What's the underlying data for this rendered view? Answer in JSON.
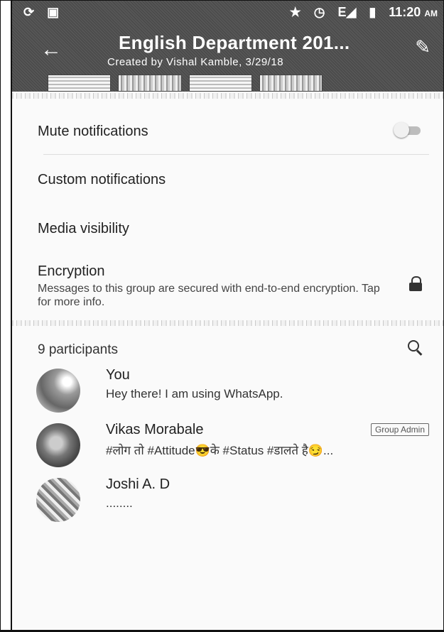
{
  "status_bar": {
    "left_icons": [
      "sync-icon",
      "gallery-icon"
    ],
    "right_icons": [
      "star-icon",
      "alarm-icon",
      "signal-icon",
      "battery-icon"
    ],
    "signal_text": "E",
    "time": "11:20",
    "ampm": "AM"
  },
  "header": {
    "title": "English Department 201...",
    "subtitle": "Created by Vishal Kamble, 3/29/18",
    "back_glyph": "←",
    "edit_glyph": "✎"
  },
  "settings": {
    "mute_label": "Mute notifications",
    "mute_enabled": false,
    "custom_label": "Custom notifications",
    "media_label": "Media visibility",
    "encryption_title": "Encryption",
    "encryption_desc": "Messages to this group are secured with end-to-end encryption. Tap for more info."
  },
  "participants": {
    "title": "9 participants",
    "members": [
      {
        "name": "You",
        "status": "Hey there! I am using WhatsApp.",
        "badge": ""
      },
      {
        "name": "Vikas Morabale",
        "status": "#लोग तो #Attitude😎के #Status #डालते है😏...",
        "badge": "Group Admin"
      },
      {
        "name": "Joshi A. D",
        "status": "........",
        "badge": ""
      }
    ]
  }
}
